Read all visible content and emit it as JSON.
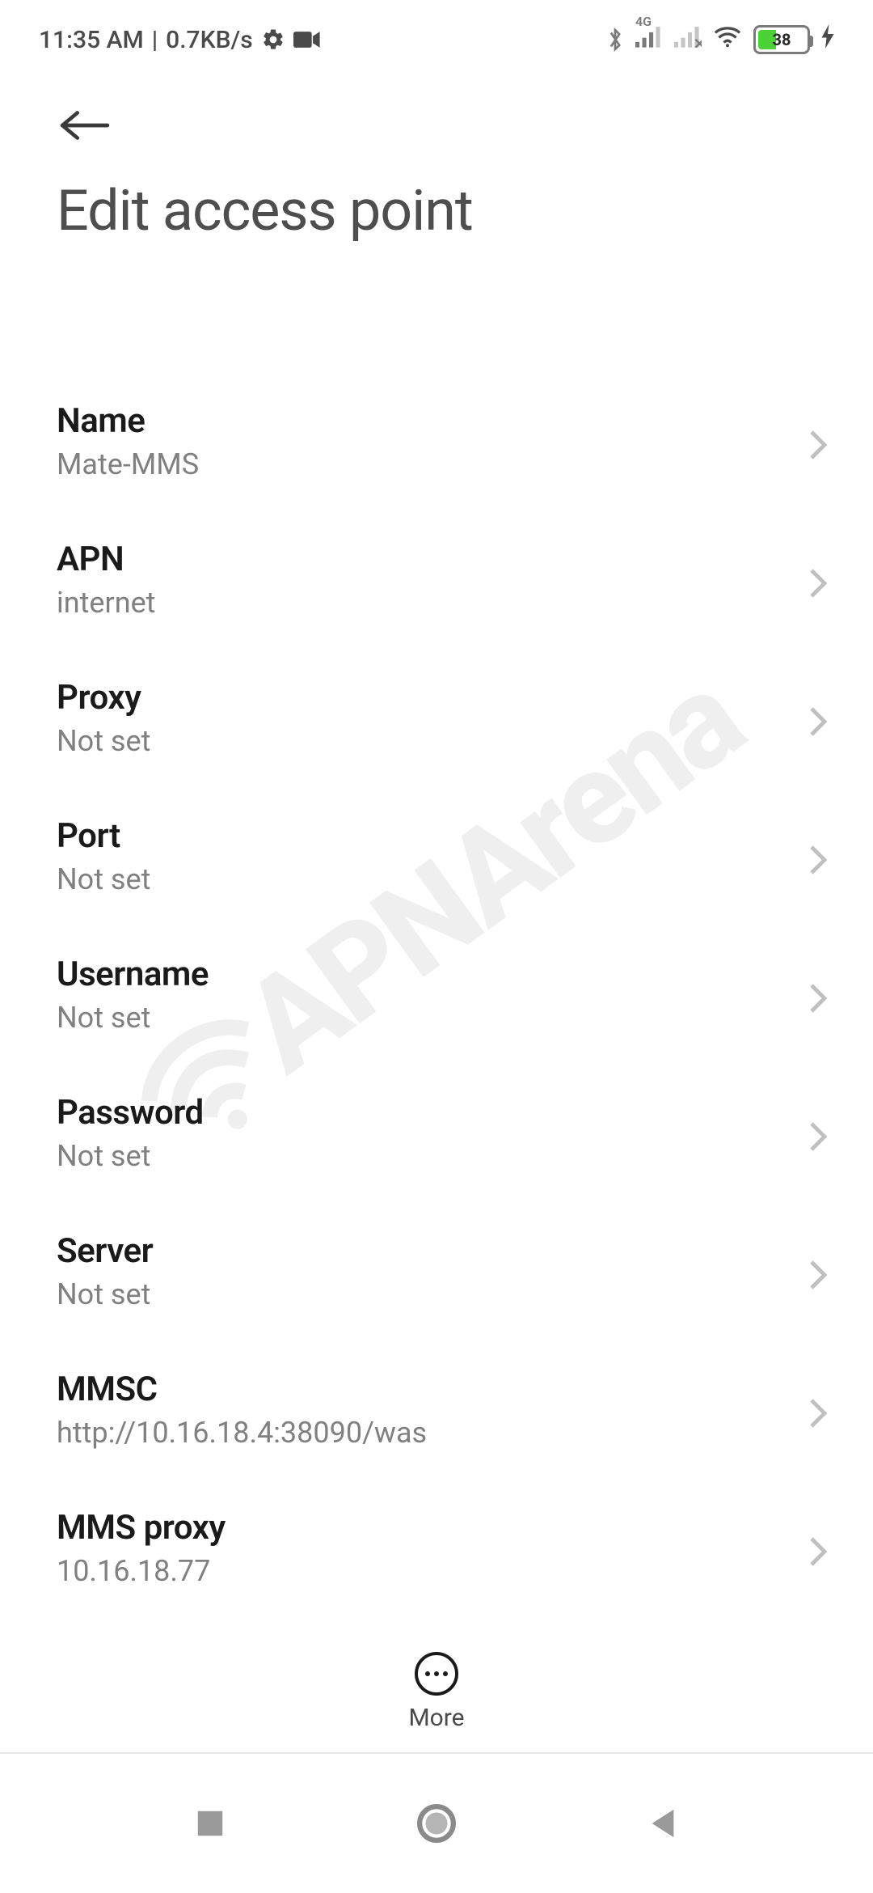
{
  "status": {
    "time": "11:35 AM",
    "speed": "0.7KB/s",
    "network_label": "4G",
    "battery_percent": "38",
    "battery_fraction": 0.38
  },
  "header": {
    "title": "Edit access point"
  },
  "rows": [
    {
      "label": "Name",
      "value": "Mate-MMS"
    },
    {
      "label": "APN",
      "value": "internet"
    },
    {
      "label": "Proxy",
      "value": "Not set"
    },
    {
      "label": "Port",
      "value": "Not set"
    },
    {
      "label": "Username",
      "value": "Not set"
    },
    {
      "label": "Password",
      "value": "Not set"
    },
    {
      "label": "Server",
      "value": "Not set"
    },
    {
      "label": "MMSC",
      "value": "http://10.16.18.4:38090/was"
    },
    {
      "label": "MMS proxy",
      "value": "10.16.18.77"
    }
  ],
  "bottom": {
    "more_label": "More"
  },
  "watermark": "APNArena"
}
